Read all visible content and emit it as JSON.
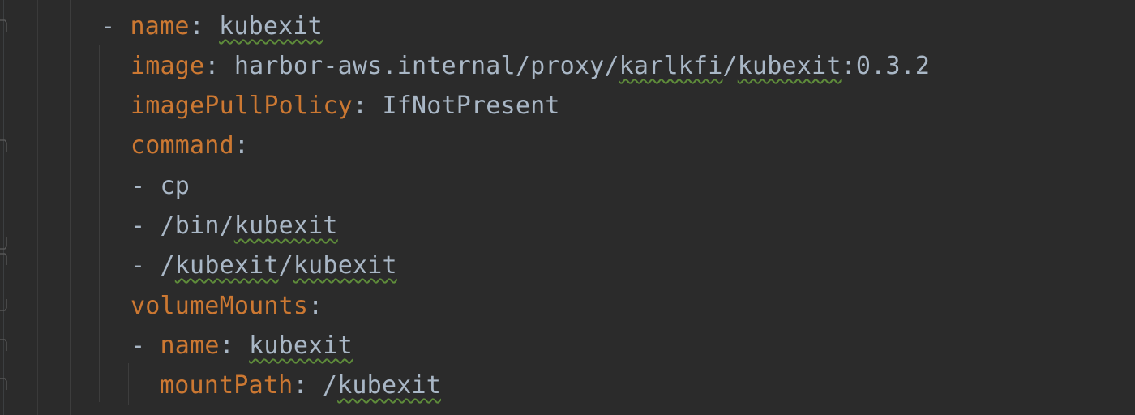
{
  "editor": {
    "language": "YAML",
    "colors": {
      "background": "#2b2b2b",
      "key": "#cc7832",
      "value": "#a9b7c6",
      "typo_underline": "#5e8c3a"
    },
    "lines": [
      {
        "dash": "- ",
        "key": "name",
        "sep": ": ",
        "value": "kubexit"
      },
      {
        "key": "image",
        "sep": ": ",
        "value_prefix": "harbor-aws.internal/proxy/",
        "value_typo1": "karlkfi",
        "value_mid": "/",
        "value_typo2": "kubexit",
        "value_suffix": ":0.3.2"
      },
      {
        "key": "imagePullPolicy",
        "sep": ": ",
        "value": "IfNotPresent"
      },
      {
        "key": "command",
        "sep": ":"
      },
      {
        "dash": "- ",
        "value": "cp"
      },
      {
        "dash": "- ",
        "value_prefix": "/bin/",
        "value_typo": "kubexit"
      },
      {
        "dash": "- ",
        "value_prefix": "/",
        "value_typo1": "kubexit",
        "value_mid": "/",
        "value_typo2": "kubexit"
      },
      {
        "key": "volumeMounts",
        "sep": ":"
      },
      {
        "dash": "- ",
        "key": "name",
        "sep": ": ",
        "value": "kubexit"
      },
      {
        "key": "mountPath",
        "sep": ": ",
        "value_prefix": "/",
        "value_typo": "kubexit"
      }
    ]
  }
}
